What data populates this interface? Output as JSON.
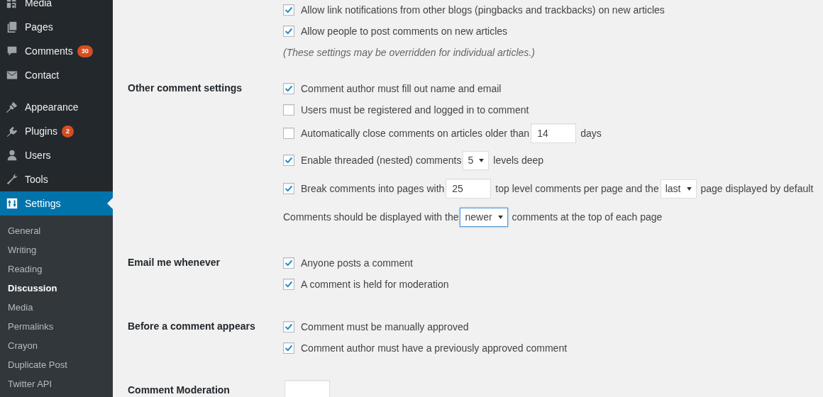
{
  "sidebar": {
    "menu_groups": [
      [
        {
          "label": "Media",
          "selected": false
        },
        {
          "label": "Pages",
          "selected": false
        },
        {
          "label": "Comments",
          "badge": "30",
          "selected": false
        },
        {
          "label": "Contact",
          "selected": false
        }
      ],
      [
        {
          "label": "Appearance",
          "selected": false
        },
        {
          "label": "Plugins",
          "badge": "2",
          "selected": false
        },
        {
          "label": "Users",
          "selected": false
        },
        {
          "label": "Tools",
          "selected": false
        },
        {
          "label": "Settings",
          "selected": true,
          "children": [
            {
              "label": "General",
              "selected": false
            },
            {
              "label": "Writing",
              "selected": false
            },
            {
              "label": "Reading",
              "selected": false
            },
            {
              "label": "Discussion",
              "selected": true
            },
            {
              "label": "Media",
              "selected": false
            },
            {
              "label": "Permalinks",
              "selected": false
            },
            {
              "label": "Crayon",
              "selected": false
            },
            {
              "label": "Duplicate Post",
              "selected": false
            },
            {
              "label": "Twitter API",
              "selected": false
            }
          ]
        }
      ]
    ]
  },
  "sections": [
    {
      "rows": [
        {
          "kind": "checkbox",
          "checked": true,
          "parts": [
            {
              "text": "Allow link notifications from other blogs (pingbacks and trackbacks) on new articles"
            }
          ]
        },
        {
          "kind": "checkbox",
          "checked": true,
          "parts": [
            {
              "text": "Allow people to post comments on new articles"
            }
          ]
        },
        {
          "kind": "note",
          "parts": [
            {
              "text": "(These settings may be overridden for individual articles.)"
            }
          ]
        }
      ]
    },
    {
      "label": "Other comment settings",
      "rows": [
        {
          "kind": "checkbox",
          "checked": true,
          "parts": [
            {
              "text": "Comment author must fill out name and email"
            }
          ]
        },
        {
          "kind": "checkbox",
          "checked": false,
          "parts": [
            {
              "text": "Users must be registered and logged in to comment"
            }
          ]
        },
        {
          "kind": "checkbox",
          "checked": false,
          "parts": [
            {
              "text": "Automatically close comments on articles older than"
            },
            {
              "input": "14"
            },
            {
              "text": "days"
            }
          ]
        },
        {
          "kind": "checkbox",
          "checked": true,
          "parts": [
            {
              "text": "Enable threaded (nested) comments"
            },
            {
              "select": "5",
              "focused": false
            },
            {
              "text": "levels deep"
            }
          ]
        },
        {
          "kind": "checkbox",
          "checked": true,
          "parts": [
            {
              "text": "Break comments into pages with"
            },
            {
              "input": "25"
            },
            {
              "text": "top level comments per page and the"
            },
            {
              "select": "last",
              "focused": false
            },
            {
              "text": "page displayed by default"
            }
          ]
        },
        {
          "kind": "text",
          "parts": [
            {
              "text": "Comments should be displayed with the"
            },
            {
              "select": "newer",
              "focused": true
            },
            {
              "text": "comments at the top of each page"
            }
          ]
        }
      ]
    },
    {
      "label": "Email me whenever",
      "rows": [
        {
          "kind": "checkbox",
          "checked": true,
          "parts": [
            {
              "text": "Anyone posts a comment"
            }
          ]
        },
        {
          "kind": "checkbox",
          "checked": true,
          "parts": [
            {
              "text": "A comment is held for moderation"
            }
          ]
        }
      ]
    },
    {
      "label": "Before a comment appears",
      "rows": [
        {
          "kind": "checkbox",
          "checked": true,
          "parts": [
            {
              "text": "Comment must be manually approved"
            }
          ]
        },
        {
          "kind": "checkbox",
          "checked": true,
          "parts": [
            {
              "text": "Comment author must have a previously approved comment"
            }
          ]
        }
      ]
    },
    {
      "label": "Comment Moderation",
      "rows": [
        {
          "kind": "field"
        }
      ]
    }
  ]
}
